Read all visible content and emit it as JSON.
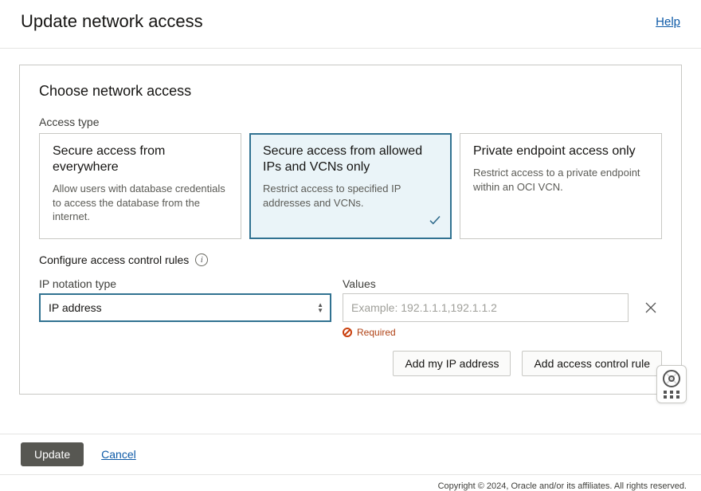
{
  "header": {
    "title": "Update network access",
    "help": "Help"
  },
  "card": {
    "title": "Choose network access",
    "access_type_label": "Access type",
    "options": [
      {
        "title": "Secure access from everywhere",
        "desc": "Allow users with database credentials to access the database from the internet.",
        "selected": false
      },
      {
        "title": "Secure access from allowed IPs and VCNs only",
        "desc": "Restrict access to specified IP addresses and VCNs.",
        "selected": true
      },
      {
        "title": "Private endpoint access only",
        "desc": "Restrict access to a private endpoint within an OCI VCN.",
        "selected": false
      }
    ],
    "acl_label": "Configure access control rules",
    "ip_type_label": "IP notation type",
    "ip_type_value": "IP address",
    "values_label": "Values",
    "values_value": "",
    "values_placeholder": "Example: 192.1.1.1,192.1.1.2",
    "required": "Required",
    "add_my_ip": "Add my IP address",
    "add_rule": "Add access control rule"
  },
  "footer": {
    "update": "Update",
    "cancel": "Cancel",
    "copyright": "Copyright © 2024, Oracle and/or its affiliates. All rights reserved."
  }
}
